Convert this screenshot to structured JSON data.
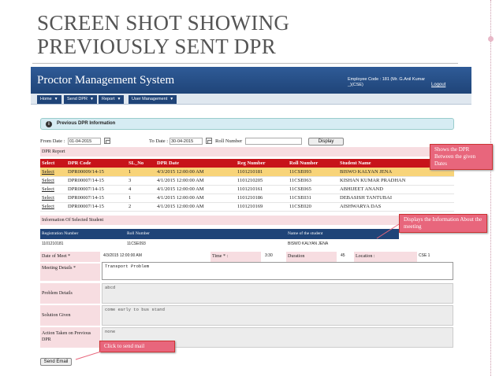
{
  "slide": {
    "title_line1": "SCREEN SHOT SHOWING",
    "title_line2": "PREVIOUSLY SENT DPR"
  },
  "app": {
    "title": "Proctor Management System",
    "employee_code": "Employee Code : 181 (Mr. G.Anil Kumar _)(CSE)",
    "logout": "Logout"
  },
  "nav": {
    "home": "Home",
    "send_dpr": "Send DPR",
    "report": "Report",
    "user_management": "User Management"
  },
  "info_bar": {
    "text": "Previous DPR Information"
  },
  "filters": {
    "from_label": "From Date :",
    "from_value": "01-04-2015",
    "to_label": "To Date :",
    "to_value": "30-04-2015",
    "roll_label": "Roll Number",
    "roll_value": "",
    "display_button": "Display"
  },
  "dpr_report": {
    "label": "DPR Report",
    "columns": [
      "Select",
      "DPR Code",
      "SL_No",
      "DPR Date",
      "Reg Number",
      "Roll Number",
      "Student Name"
    ],
    "rows": [
      [
        "Select",
        "DPR00009/14-15",
        "1",
        "4/3/2015 12:00:00 AM",
        "1101210181",
        "11CSE093",
        "BISWO KALYAN JENA"
      ],
      [
        "Select",
        "DPR00007/14-15",
        "3",
        "4/1/2015 12:00:00 AM",
        "1101210205",
        "11CSE063",
        "KISHAN KUMAR PRADHAN"
      ],
      [
        "Select",
        "DPR00007/14-15",
        "4",
        "4/1/2015 12:00:00 AM",
        "1101210161",
        "11CSE065",
        "ABHIJEET ANAND"
      ],
      [
        "Select",
        "DPR00007/14-15",
        "1",
        "4/1/2015 12:00:00 AM",
        "1101210186",
        "11CSE031",
        "DEBASISH TANTUBAI"
      ],
      [
        "Select",
        "DPR00007/14-15",
        "2",
        "4/1/2015 12:00:00 AM",
        "1101210169",
        "11CSE020",
        "AISHWARYA DAS"
      ]
    ]
  },
  "selected_student": {
    "label": "Information Of Selected Student",
    "h_reg": "Registration Number",
    "h_roll": "Roll Number",
    "h_name": "Name of the student",
    "reg": "1101210181",
    "roll": "11CSE093",
    "name": "BISWO KALYAN JENA"
  },
  "meeting": {
    "date_label": "Date of Meet *",
    "date_value": "4/3/2015 12:00:00 AM",
    "time_label": "Time * :",
    "time_value": "3:30",
    "duration_label": "Duration",
    "duration_value": "45",
    "location_label": "Location :",
    "location_value": "CSE 1",
    "details_label": "Meeting Details *",
    "details_value": "Transport Problem",
    "problem_label": "Problem Details",
    "problem_value": "abcd",
    "solution_label": "Solution Given",
    "solution_value": "come early to bus stand",
    "action_label": "Action Taken on Previous DPR",
    "action_value": "none",
    "send_button": "Send Email"
  },
  "callouts": {
    "dates": "Shows the DPR Between the given Dates",
    "info": "Displays the Information About the meeting",
    "mail": "Click to send mail"
  },
  "colors": {
    "header": "#1f4478",
    "table_header": "#c7131a",
    "selected_row": "#f8d479",
    "label_pink": "#f7dde1",
    "callout": "#e8667c"
  }
}
